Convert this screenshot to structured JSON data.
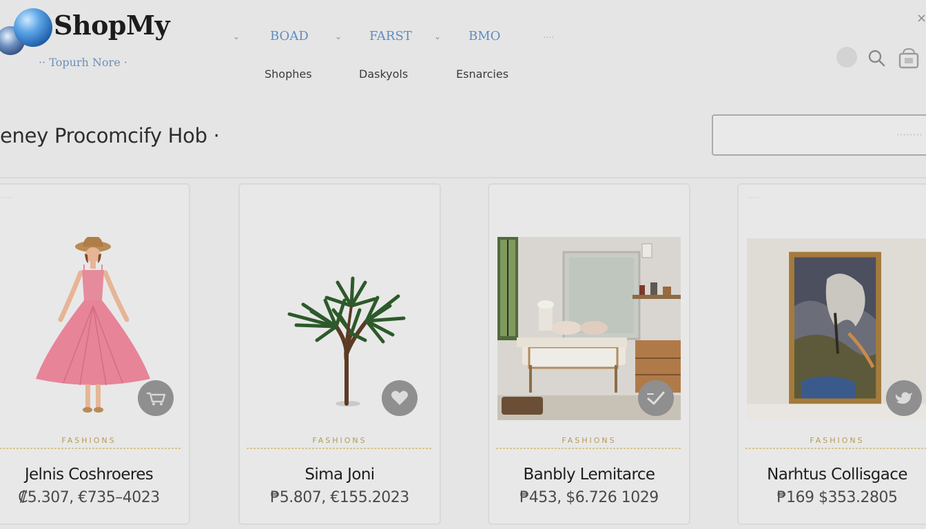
{
  "brand": {
    "name": "ShopMy",
    "tagline": "·· Topurh Nore ·"
  },
  "nav": {
    "top": [
      {
        "label": "BOAD"
      },
      {
        "label": "FARST"
      },
      {
        "label": "BMO"
      },
      {
        "label": "····"
      }
    ],
    "sub": [
      {
        "label": "Shophes"
      },
      {
        "label": "Daskyols"
      },
      {
        "label": "Esnarcies"
      }
    ]
  },
  "header_icons": [
    "user-icon",
    "search-icon",
    "shopping-bag-icon",
    "close-icon"
  ],
  "close_label": "×",
  "page_title": "eney Procomcify Hob ·",
  "search": {
    "placeholder": "········"
  },
  "products": [
    {
      "name": "Jelnis Coshroeres",
      "price": "₡5.307, €735–4023",
      "brand_line": "FASHIONS",
      "image": "pink-dress-figure",
      "action_icon": "cart-icon"
    },
    {
      "name": "Sima Joni",
      "price": "₱5.807, €155.2023",
      "brand_line": "FASHIONS",
      "image": "palm-tree",
      "action_icon": "heart-icon"
    },
    {
      "name": "Banbly Lemitarce",
      "price": "₱453, $6.726 1029",
      "brand_line": "FASHIONS",
      "image": "bedroom-interior",
      "action_icon": "checkmark-icon"
    },
    {
      "name": "Narhtus Collisgace",
      "price": "₱169 $353.2805",
      "brand_line": "FASHIONS",
      "image": "framed-painting",
      "action_icon": "bird-icon"
    }
  ],
  "colors": {
    "background": "#e5e5e5",
    "accent_blue": "#5d8cc0",
    "gold": "#b49a55",
    "fav_button": "#8f8f8f"
  }
}
